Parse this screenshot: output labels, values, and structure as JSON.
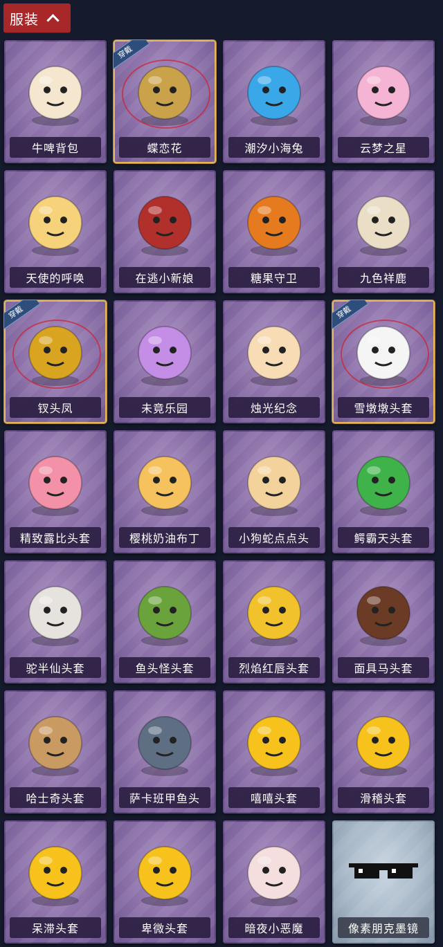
{
  "header": {
    "title": "服装",
    "chevron_icon": "chevron-up-icon"
  },
  "equipped_badge": "穿戴",
  "items": [
    {
      "name": "牛啤背包",
      "equipped": false,
      "icon": "cow-beer-barrel-icon",
      "color": "#f4e6cf"
    },
    {
      "name": "蝶恋花",
      "equipped": true,
      "icon": "butterfly-bell-icon",
      "color": "#c9a24a"
    },
    {
      "name": "潮汐小海兔",
      "equipped": false,
      "icon": "sea-rabbit-icon",
      "color": "#39a7e8"
    },
    {
      "name": "云梦之星",
      "equipped": false,
      "icon": "unicorn-cloud-icon",
      "color": "#f5b4d4"
    },
    {
      "name": "天使的呼唤",
      "equipped": false,
      "icon": "angel-doll-icon",
      "color": "#f6d27a"
    },
    {
      "name": "在逃小新娘",
      "equipped": false,
      "icon": "red-bride-icon",
      "color": "#b1302b"
    },
    {
      "name": "糖果守卫",
      "equipped": false,
      "icon": "pumpkin-guard-icon",
      "color": "#e67a1e"
    },
    {
      "name": "九色祥鹿",
      "equipped": false,
      "icon": "golden-deer-icon",
      "color": "#eadfc6"
    },
    {
      "name": "钗头凤",
      "equipped": true,
      "icon": "phoenix-crown-icon",
      "color": "#d9a520"
    },
    {
      "name": "未竟乐园",
      "equipped": false,
      "icon": "fairy-girl-icon",
      "color": "#c48ee6"
    },
    {
      "name": "烛光纪念",
      "equipped": false,
      "icon": "candle-icon",
      "color": "#f7dcb6"
    },
    {
      "name": "雪墩墩头套",
      "equipped": true,
      "icon": "snowman-head-icon",
      "color": "#f5f5f5"
    },
    {
      "name": "精致露比头套",
      "equipped": false,
      "icon": "pink-beaver-head-icon",
      "color": "#f291a7"
    },
    {
      "name": "樱桃奶油布丁",
      "equipped": false,
      "icon": "pudding-head-icon",
      "color": "#f5c25e"
    },
    {
      "name": "小狗蛇点点头",
      "equipped": false,
      "icon": "dog-snake-head-icon",
      "color": "#f3d39b"
    },
    {
      "name": "鳄霸天头套",
      "equipped": false,
      "icon": "crocodile-head-icon",
      "color": "#3fb34a"
    },
    {
      "name": "驼半仙头套",
      "equipped": false,
      "icon": "bear-sunglasses-head-icon",
      "color": "#e6e2de"
    },
    {
      "name": "鱼头怪头套",
      "equipped": false,
      "icon": "fish-head-icon",
      "color": "#6aa33c"
    },
    {
      "name": "烈焰红唇头套",
      "equipped": false,
      "icon": "yellow-mask-head-icon",
      "color": "#f2c22c"
    },
    {
      "name": "面具马头套",
      "equipped": false,
      "icon": "horse-head-icon",
      "color": "#6b3b25"
    },
    {
      "name": "哈士奇头套",
      "equipped": false,
      "icon": "husky-head-icon",
      "color": "#c99a62"
    },
    {
      "name": "萨卡班甲鱼头",
      "equipped": false,
      "icon": "sacabambaspis-head-icon",
      "color": "#5e6f84"
    },
    {
      "name": "嘻嘻头套",
      "equipped": false,
      "icon": "grin-emoji-head-icon",
      "color": "#f6c21b"
    },
    {
      "name": "滑稽头套",
      "equipped": false,
      "icon": "funny-emoji-head-icon",
      "color": "#f6c21b"
    },
    {
      "name": "呆滞头套",
      "equipped": false,
      "icon": "dazed-emoji-head-icon",
      "color": "#f6c21b"
    },
    {
      "name": "卑微头套",
      "equipped": false,
      "icon": "humble-emoji-head-icon",
      "color": "#f6c21b"
    },
    {
      "name": "暗夜小恶魔",
      "equipped": false,
      "icon": "little-devil-icon",
      "color": "#f5dede"
    },
    {
      "name": "像素朋克墨镜",
      "equipped": false,
      "icon": "pixel-sunglasses-icon",
      "color": "#111111",
      "special": true
    }
  ]
}
